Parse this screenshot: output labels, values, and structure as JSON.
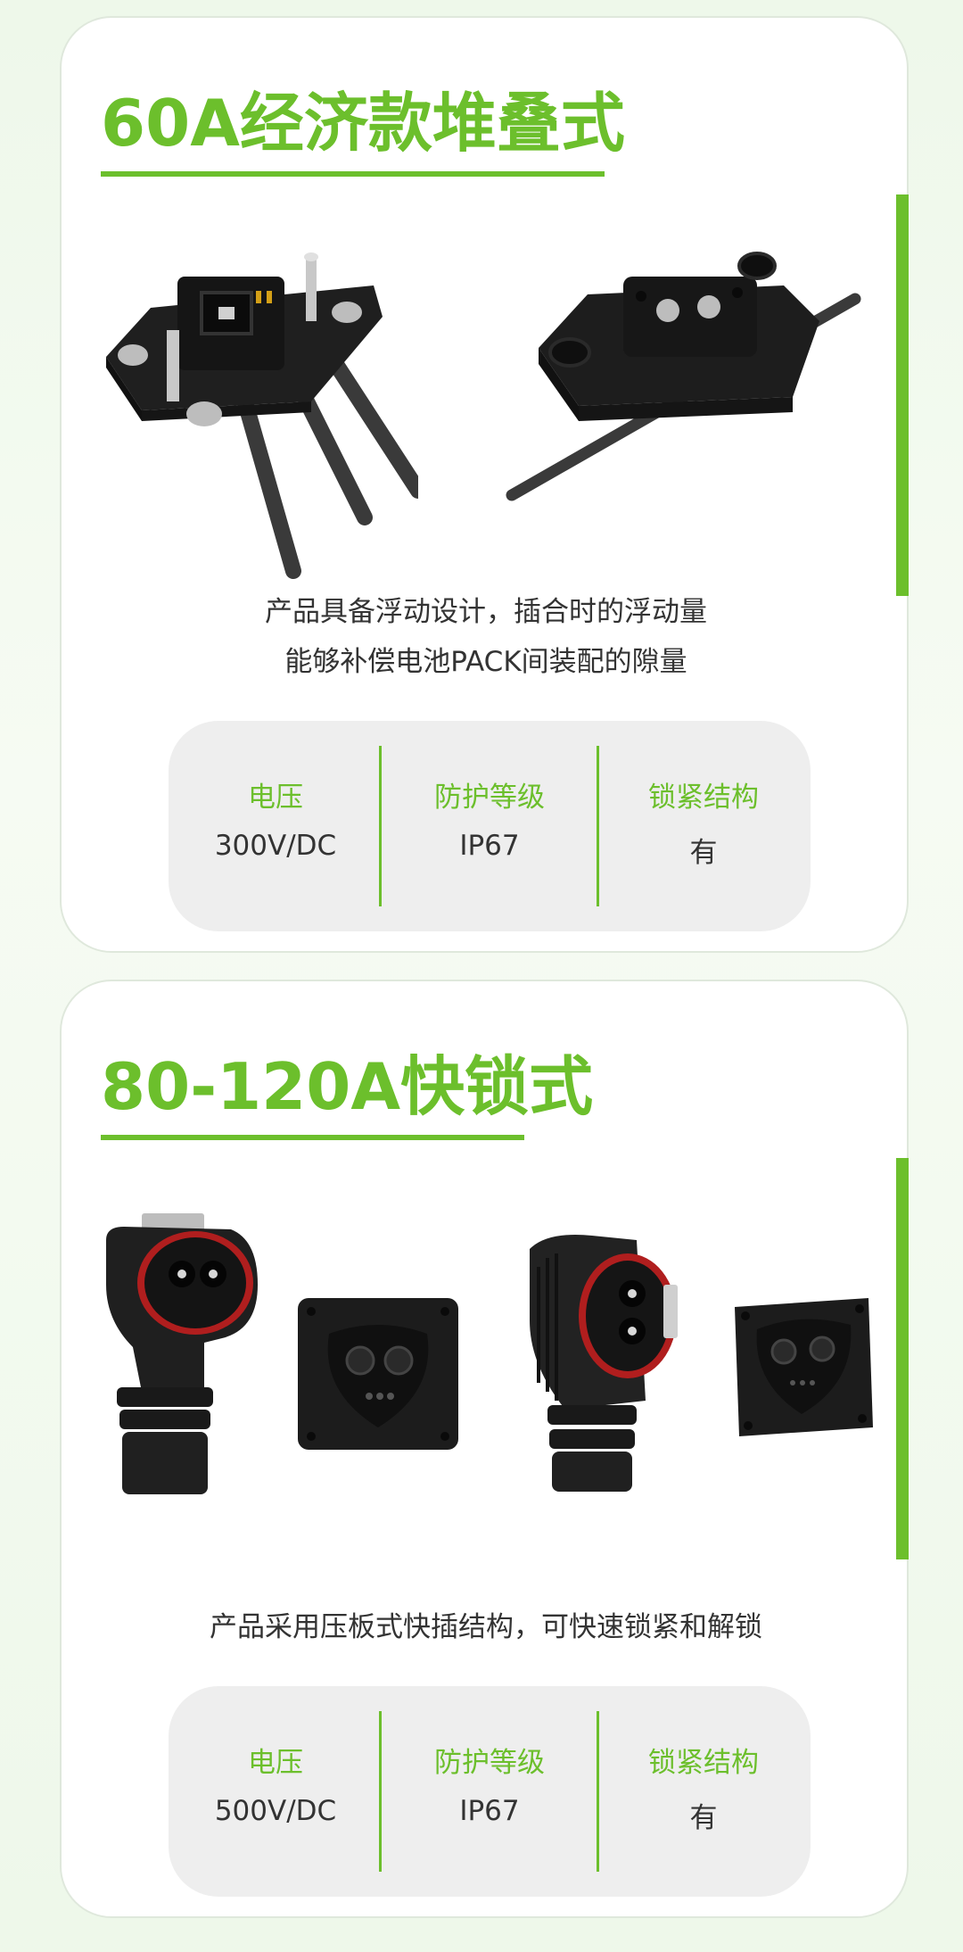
{
  "cards": [
    {
      "title": "60A经济款堆叠式",
      "description_lines": [
        "产品具备浮动设计，插合时的浮动量",
        "能够补偿电池PACK间装配的隙量"
      ],
      "specs": [
        {
          "label": "电压",
          "value": "300V/DC"
        },
        {
          "label": "防护等级",
          "value": "IP67"
        },
        {
          "label": "锁紧结构",
          "value": "有"
        }
      ]
    },
    {
      "title": "80-120A快锁式",
      "description_lines": [
        "产品采用压板式快插结构，可快速锁紧和解锁"
      ],
      "specs": [
        {
          "label": "电压",
          "value": "500V/DC"
        },
        {
          "label": "防护等级",
          "value": "IP67"
        },
        {
          "label": "锁紧结构",
          "value": "有"
        }
      ]
    }
  ],
  "colors": {
    "accent": "#6cbf2c",
    "text": "#333333",
    "spec_bg": "#eeeeee"
  }
}
